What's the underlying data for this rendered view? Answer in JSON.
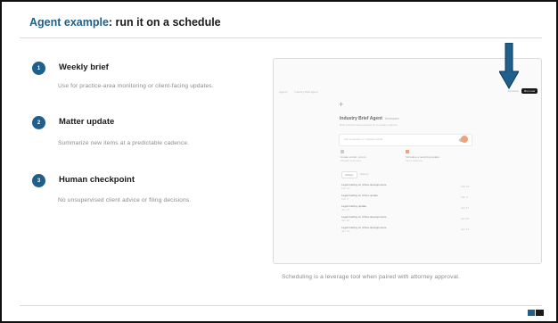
{
  "slide": {
    "title_accent": "Agent example",
    "title_rest": ": run it on a schedule",
    "caption": "Scheduling is a leverage tool when paired with attorney approval."
  },
  "steps": [
    {
      "number": "1",
      "title": "Weekly brief",
      "description": "Use for practice-area monitoring or client-facing updates."
    },
    {
      "number": "2",
      "title": "Matter update",
      "description": "Summarize new items at a predictable cadence."
    },
    {
      "number": "3",
      "title": "Human checkpoint",
      "description": "No unsupervised client advice or filing decisions."
    }
  ],
  "mock_app": {
    "breadcrumb": "Agents",
    "breadcrumb_faint": "Industry Brief Agent",
    "schedule_link": "Schedule",
    "run_button": "Run now",
    "agent_name": "Industry Brief Agent",
    "agent_badge": "Workspace",
    "subtitle": "Brief practice-area updates on a weekly cadence",
    "input_placeholder": "Ask a question or request a brief",
    "card_left": [
      "Create a brief, a form",
      "Weekly summary"
    ],
    "card_right": [
      "Schedule a recurring update",
      "Set a cadence"
    ],
    "tabs": [
      "Activity",
      "History"
    ],
    "runs": [
      {
        "name": "Legal briefing on China developments",
        "sub": "Feb 10",
        "time": "Feb 10"
      },
      {
        "name": "Legal briefing on China update",
        "sub": "Feb 3",
        "time": "Feb 3"
      },
      {
        "name": "Legal briefing update",
        "sub": "Jan 27",
        "time": "Jan 27"
      },
      {
        "name": "Legal briefing on China developments",
        "sub": "Jan 20",
        "time": "Jan 20"
      },
      {
        "name": "Legal briefing on China developments",
        "sub": "Jan 13",
        "time": "Jan 13"
      }
    ]
  },
  "colors": {
    "accent": "#1f5f8b",
    "text": "#1a1a1a",
    "muted": "#8a8a8a",
    "arrow": "#1f5f8b"
  }
}
